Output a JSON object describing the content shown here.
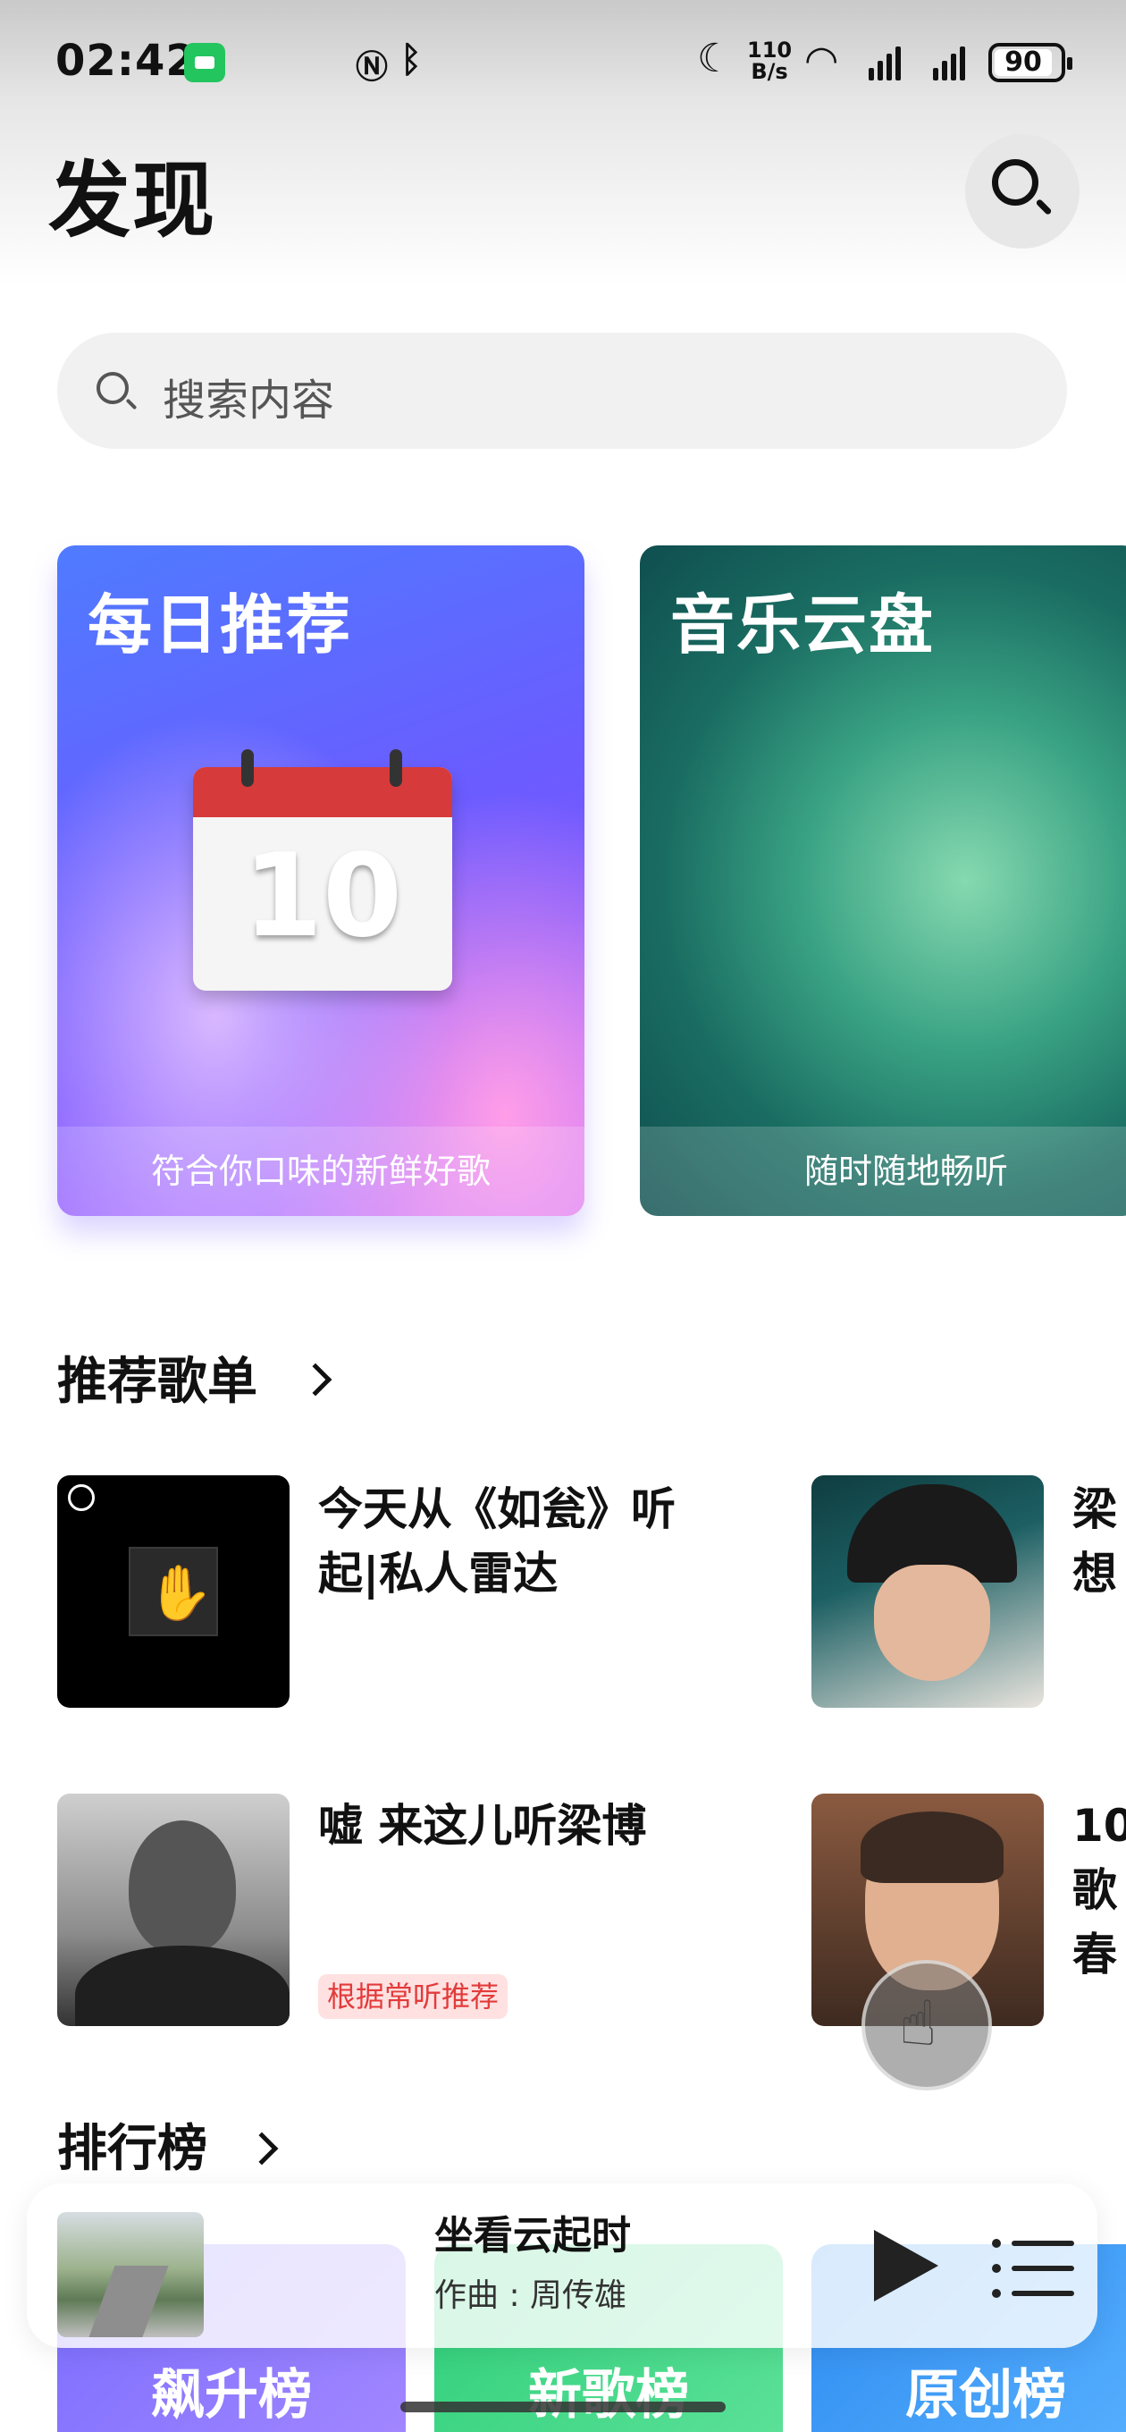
{
  "status_bar": {
    "time": "02:42",
    "net_speed_value": "110",
    "net_speed_unit": "B/s",
    "battery": "90"
  },
  "header": {
    "title": "发现"
  },
  "search": {
    "placeholder": "搜索内容"
  },
  "feature_cards": [
    {
      "title": "每日推荐",
      "subtitle": "符合你口味的新鲜好歌",
      "calendar_day": "10"
    },
    {
      "title": "音乐云盘",
      "subtitle": "随时随地畅听"
    }
  ],
  "playlists": {
    "section_title": "推荐歌单",
    "items": [
      {
        "title_line1": "今天从《如瓮》听",
        "title_line2": "起|私人雷达"
      },
      {
        "title_line1": "梁",
        "title_line2": "想"
      },
      {
        "title_line1": "嘘 来这儿听梁博",
        "tag": "根据常听推荐"
      },
      {
        "title_line1": "10",
        "title_line2": "歌",
        "title_line3": "春"
      }
    ]
  },
  "charts_section": {
    "title": "排行榜",
    "tiles": [
      "飙升榜",
      "新歌榜",
      "原创榜"
    ]
  },
  "mini_player": {
    "title": "坐看云起时",
    "subtitle": "作曲 : 周传雄"
  },
  "colors": {
    "tag_text": "#e23b3b",
    "tag_bg": "#ffe1e1",
    "status_badge": "#22c55e"
  }
}
